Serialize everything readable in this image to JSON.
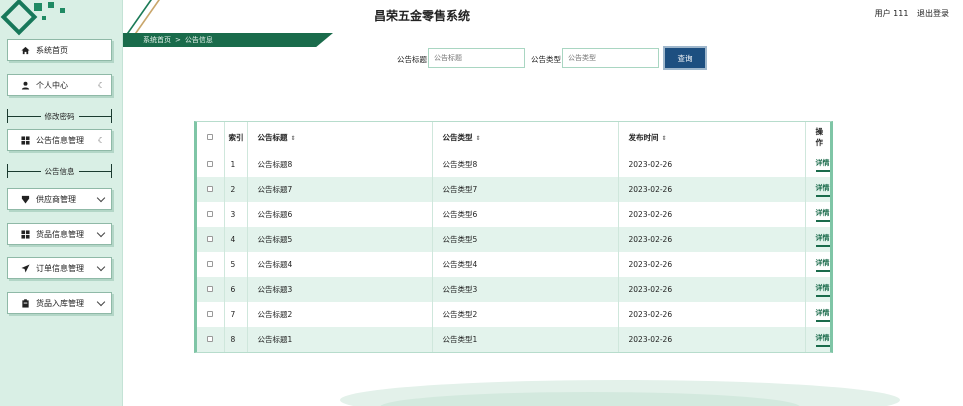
{
  "app": {
    "title": "昌荣五金零售系统"
  },
  "user": {
    "label": "用户 111",
    "logout": "退出登录"
  },
  "breadcrumb": {
    "home": "系统首页",
    "separator": ">",
    "current": "公告信息"
  },
  "sidebar": {
    "items": [
      {
        "label": "系统首页",
        "icon": "home-icon"
      },
      {
        "label": "个人中心",
        "icon": "user-icon"
      },
      {
        "label": "修改密码",
        "sub": true
      },
      {
        "label": "公告信息管理",
        "icon": "grid-icon"
      },
      {
        "label": "公告信息",
        "sub": true
      },
      {
        "label": "供应商管理",
        "icon": "shield-icon"
      },
      {
        "label": "货品信息管理",
        "icon": "grid-icon"
      },
      {
        "label": "订单信息管理",
        "icon": "send-icon"
      },
      {
        "label": "货品入库管理",
        "icon": "clipboard-icon"
      }
    ]
  },
  "search": {
    "title_label": "公告标题",
    "title_placeholder": "公告标题",
    "type_label": "公告类型",
    "type_placeholder": "公告类型",
    "button": "查询"
  },
  "table": {
    "columns": {
      "index": "索引",
      "title": "公告标题",
      "type": "公告类型",
      "time": "发布时间",
      "action": "操作"
    },
    "rows": [
      {
        "index": "1",
        "title": "公告标题8",
        "type": "公告类型8",
        "time": "2023-02-26",
        "action": "详情"
      },
      {
        "index": "2",
        "title": "公告标题7",
        "type": "公告类型7",
        "time": "2023-02-26",
        "action": "详情"
      },
      {
        "index": "3",
        "title": "公告标题6",
        "type": "公告类型6",
        "time": "2023-02-26",
        "action": "详情"
      },
      {
        "index": "4",
        "title": "公告标题5",
        "type": "公告类型5",
        "time": "2023-02-26",
        "action": "详情"
      },
      {
        "index": "5",
        "title": "公告标题4",
        "type": "公告类型4",
        "time": "2023-02-26",
        "action": "详情"
      },
      {
        "index": "6",
        "title": "公告标题3",
        "type": "公告类型3",
        "time": "2023-02-26",
        "action": "详情"
      },
      {
        "index": "7",
        "title": "公告标题2",
        "type": "公告类型2",
        "time": "2023-02-26",
        "action": "详情"
      },
      {
        "index": "8",
        "title": "公告标题1",
        "type": "公告类型1",
        "time": "2023-02-26",
        "action": "详情"
      }
    ]
  },
  "colors": {
    "accent": "#1a6b4b",
    "sidebar_bg": "#d9efe5",
    "button": "#1d4f80",
    "row_alt": "#e3f3ec"
  }
}
